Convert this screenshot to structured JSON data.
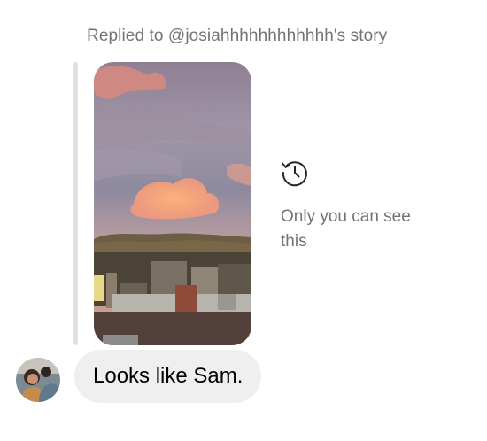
{
  "reply": {
    "header": "Replied to @josiahhhhhhhhhhhh's story",
    "visibility_note": "Only you can see this",
    "visibility_icon": "history-icon"
  },
  "story": {
    "thumbnail": "sunset-rooftops-image"
  },
  "message": {
    "text": "Looks like Sam."
  },
  "avatar": {
    "icon": "user-avatar"
  }
}
